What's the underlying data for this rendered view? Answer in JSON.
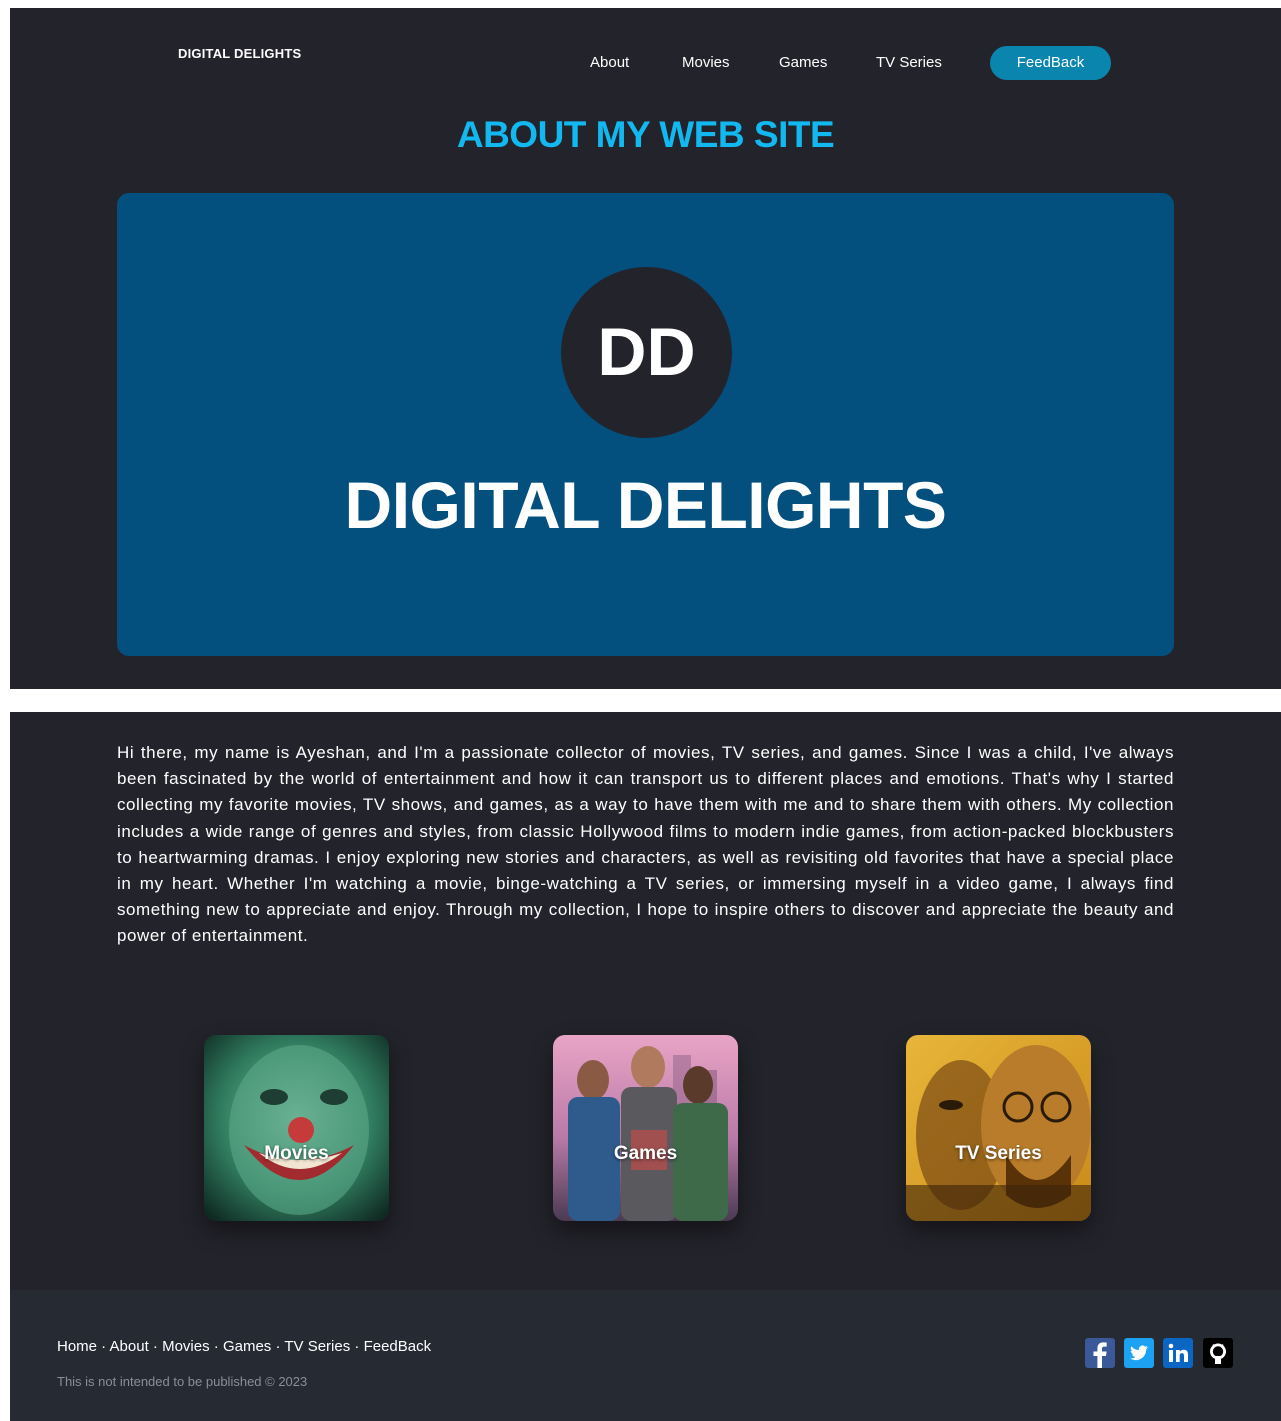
{
  "header": {
    "brand": "DIGITAL DELIGHTS",
    "nav": [
      "About",
      "Movies",
      "Games",
      "TV Series"
    ],
    "feedback_button": "FeedBack"
  },
  "page_title": "ABOUT MY WEB SITE",
  "hero": {
    "monogram": "DD",
    "title": "DIGITAL DELIGHTS"
  },
  "about_text": "Hi there, my name is Ayeshan, and I'm a passionate collector of movies, TV series, and games. Since I was a child, I've always been fascinated by the world of entertainment and how it can transport us to different places and emotions. That's why I started collecting my favorite movies, TV shows, and games, as a way to have them with me and to share them with others. My collection includes a wide range of genres and styles, from classic Hollywood films to modern indie games, from action-packed blockbusters to heartwarming dramas. I enjoy exploring new stories and characters, as well as revisiting old favorites that have a special place in my heart. Whether I'm watching a movie, binge-watching a TV series, or immersing myself in a video game, I always find something new to appreciate and enjoy. Through my collection, I hope to inspire others to discover and appreciate the beauty and power of entertainment.",
  "cards": [
    {
      "label": "Movies"
    },
    {
      "label": "Games"
    },
    {
      "label": "TV Series"
    }
  ],
  "footer": {
    "links": [
      "Home",
      "About",
      "Movies",
      "Games",
      "TV Series",
      "FeedBack"
    ],
    "separator": " · ",
    "note": "This is not intended to be published © 2023",
    "social": [
      "facebook-icon",
      "twitter-icon",
      "linkedin-icon",
      "github-icon"
    ]
  },
  "colors": {
    "background": "#23232b",
    "accent": "#12b8f0",
    "button": "#0a86ae",
    "hero": "#03507f",
    "footer": "#262a33"
  }
}
